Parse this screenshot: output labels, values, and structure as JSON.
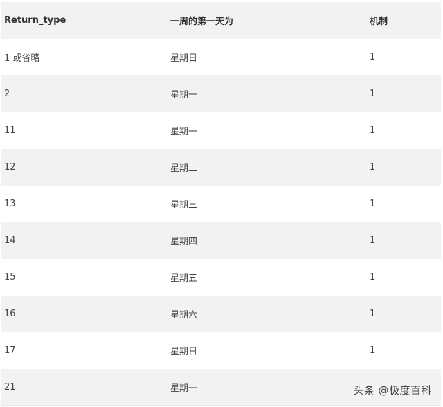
{
  "table": {
    "headers": [
      "Return_type",
      "一周的第一天为",
      "机制"
    ],
    "rows": [
      [
        "1 或省略",
        "星期日",
        "1"
      ],
      [
        "2",
        "星期一",
        "1"
      ],
      [
        "11",
        "星期一",
        "1"
      ],
      [
        "12",
        "星期二",
        "1"
      ],
      [
        "13",
        "星期三",
        "1"
      ],
      [
        "14",
        "星期四",
        "1"
      ],
      [
        "15",
        "星期五",
        "1"
      ],
      [
        "16",
        "星期六",
        "1"
      ],
      [
        "17",
        "星期日",
        "1"
      ],
      [
        "21",
        "星期一",
        ""
      ]
    ]
  },
  "watermark": "头条 @极度百科"
}
